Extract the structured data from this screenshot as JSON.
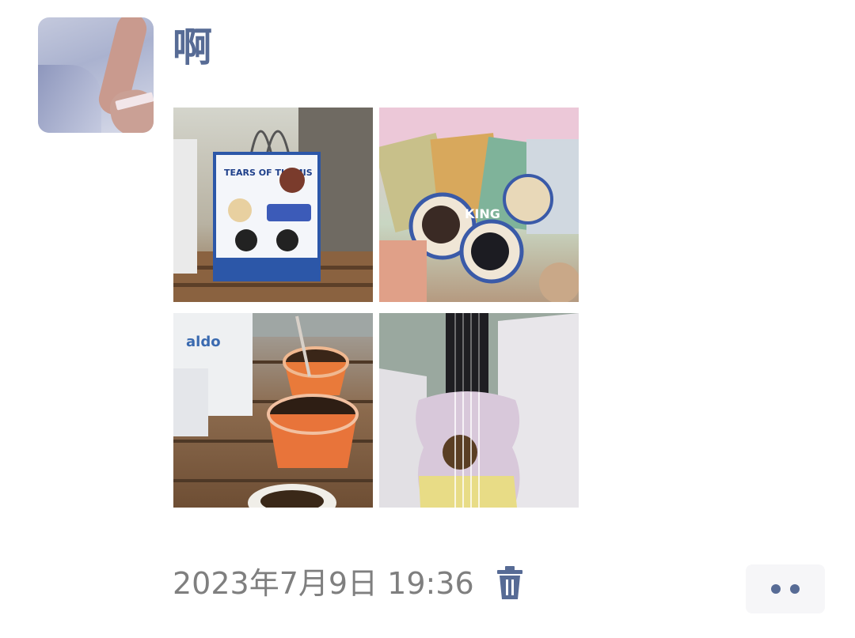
{
  "post": {
    "username": "啊",
    "timestamp": "2023年7月9日 19:36"
  },
  "photos": [
    {
      "name": "photo-themis-bag",
      "label": "TEARS OF THEMIS"
    },
    {
      "name": "photo-cards",
      "label": "KING"
    },
    {
      "name": "photo-drink-cups",
      "label": "aldo"
    },
    {
      "name": "photo-ukulele"
    }
  ],
  "icons": {
    "delete": "trash-icon",
    "more": "more-dots-icon"
  },
  "colors": {
    "bg": "#ffffff",
    "name": "#576b95",
    "meta": "#7f7f7f",
    "pill": "#f6f6f8"
  }
}
